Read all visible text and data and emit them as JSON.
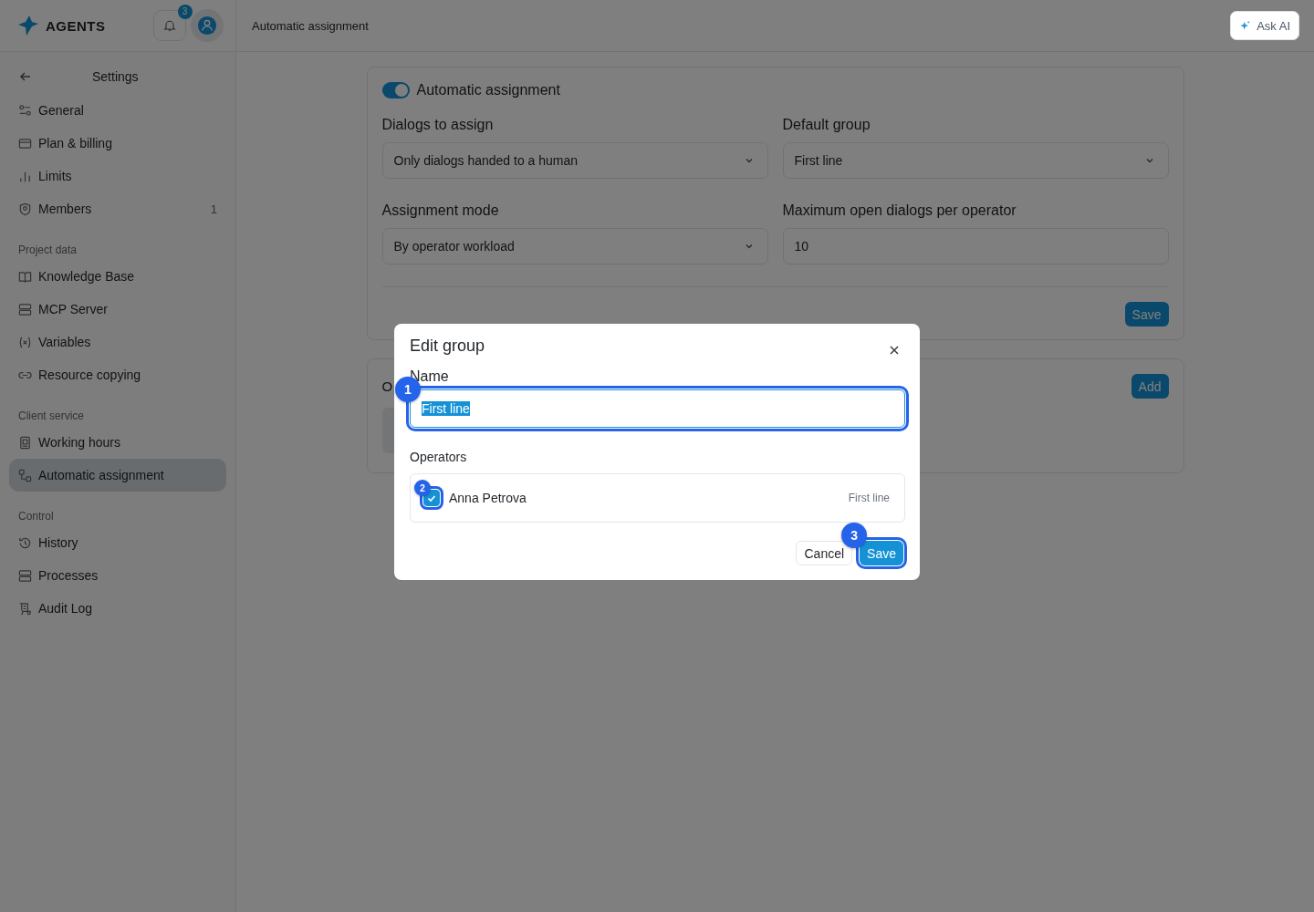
{
  "brand": {
    "name": "AGENTS"
  },
  "header": {
    "notifications": "3",
    "breadcrumb": "Automatic assignment",
    "ask_ai": "Ask AI"
  },
  "sidebar": {
    "back_title": "Settings",
    "sections": [
      {
        "items": [
          {
            "label": "General",
            "selected": false
          },
          {
            "label": "Plan & billing",
            "selected": false
          },
          {
            "label": "Limits",
            "selected": false
          },
          {
            "label": "Members",
            "count": "1",
            "selected": false
          }
        ]
      },
      {
        "title": "Project data",
        "items": [
          {
            "label": "Knowledge Base",
            "selected": false
          },
          {
            "label": "MCP Server",
            "selected": false
          },
          {
            "label": "Variables",
            "selected": false
          },
          {
            "label": "Resource copying",
            "selected": false
          }
        ]
      },
      {
        "title": "Client service",
        "items": [
          {
            "label": "Working hours",
            "selected": false
          },
          {
            "label": "Automatic assignment",
            "selected": true
          }
        ]
      },
      {
        "title": "Control",
        "items": [
          {
            "label": "History",
            "selected": false
          },
          {
            "label": "Processes",
            "selected": false
          },
          {
            "label": "Audit Log",
            "selected": false
          }
        ]
      }
    ]
  },
  "settings_card": {
    "toggle": {
      "label": "Automatic assignment",
      "on": true
    },
    "fields": [
      {
        "label": "Dialogs to assign",
        "kind": "select",
        "value": "Only dialogs handed to a human"
      },
      {
        "label": "Default group",
        "kind": "select",
        "value": "First line"
      },
      {
        "label": "Assignment mode",
        "kind": "select",
        "value": "By operator workload"
      },
      {
        "label": "Maximum open dialogs per operator",
        "kind": "input",
        "value": "10"
      }
    ],
    "save": "Save"
  },
  "groups_card": {
    "title": "O",
    "add": "Add"
  },
  "modal": {
    "title": "Edit group",
    "name_label": "Name",
    "name_value": "First line",
    "name_marker": "1",
    "operators_label": "Operators",
    "operators": [
      {
        "name": "Anna Petrova",
        "group": "First line",
        "checked": true,
        "marker": "2"
      }
    ],
    "cancel": "Cancel",
    "save": "Save",
    "save_marker": "3"
  }
}
